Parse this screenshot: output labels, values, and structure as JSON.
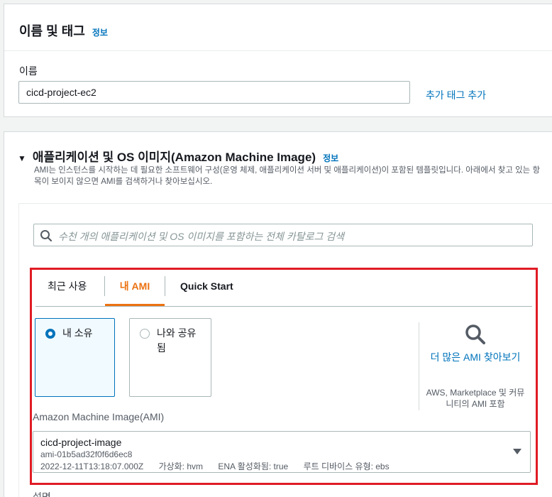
{
  "name_section": {
    "title": "이름 및 태그",
    "info": "정보",
    "name_label": "이름",
    "name_value": "cicd-project-ec2",
    "add_tag": "추가 태그 추가"
  },
  "ami_section": {
    "title": "애플리케이션 및 OS 이미지(Amazon Machine Image)",
    "info": "정보",
    "description": "AMI는 인스턴스를 시작하는 데 필요한 소프트웨어 구성(운영 체제, 애플리케이션 서버 및 애플리케이션)이 포함된 템플릿입니다. 아래에서 찾고 있는 항목이 보이지 않으면 AMI를 검색하거나 찾아보십시오.",
    "search_placeholder": "수천 개의 애플리케이션 및 OS 이미지를 포함하는 전체 카탈로그 검색",
    "tabs": [
      "최근 사용",
      "내 AMI",
      "Quick Start"
    ],
    "active_tab": "내 AMI",
    "radio_options": [
      "내 소유",
      "나와 공유됨"
    ],
    "selected_option": "내 소유",
    "browse_link": "더 많은 AMI 찾아보기",
    "browse_sub": "AWS, Marketplace 및 커뮤니티의 AMI 포함",
    "field_label": "Amazon Machine Image(AMI)",
    "selected_ami": {
      "name": "cicd-project-image",
      "id": "ami-01b5ad32f0f6d6ec8",
      "date": "2022-12-11T13:18:07.000Z",
      "virtualization": "가상화: hvm",
      "ena": "ENA 활성화됨: true",
      "root_device": "루트 디바이스 유형: ebs"
    },
    "next_label": "설명"
  },
  "colors": {
    "accent_orange": "#ec7211",
    "link_blue": "#0073bb",
    "highlight_red": "#e01b24"
  }
}
